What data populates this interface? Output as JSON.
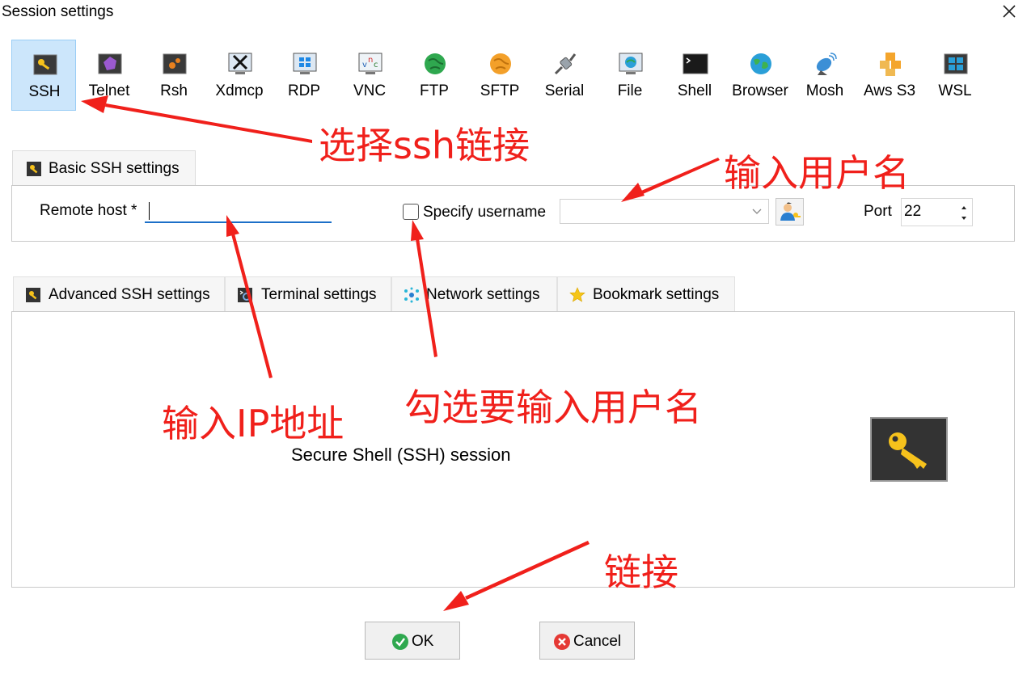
{
  "window": {
    "title": "Session settings"
  },
  "session_types": [
    {
      "label": "SSH",
      "icon": "ssh-key-icon",
      "selected": true
    },
    {
      "label": "Telnet",
      "icon": "telnet-icon",
      "selected": false
    },
    {
      "label": "Rsh",
      "icon": "rsh-icon",
      "selected": false
    },
    {
      "label": "Xdmcp",
      "icon": "xdmcp-icon",
      "selected": false
    },
    {
      "label": "RDP",
      "icon": "rdp-icon",
      "selected": false
    },
    {
      "label": "VNC",
      "icon": "vnc-icon",
      "selected": false
    },
    {
      "label": "FTP",
      "icon": "ftp-globe-icon",
      "selected": false
    },
    {
      "label": "SFTP",
      "icon": "sftp-globe-icon",
      "selected": false
    },
    {
      "label": "Serial",
      "icon": "serial-plug-icon",
      "selected": false
    },
    {
      "label": "File",
      "icon": "file-monitor-icon",
      "selected": false
    },
    {
      "label": "Shell",
      "icon": "shell-terminal-icon",
      "selected": false
    },
    {
      "label": "Browser",
      "icon": "browser-globe-icon",
      "selected": false
    },
    {
      "label": "Mosh",
      "icon": "mosh-satellite-icon",
      "selected": false
    },
    {
      "label": "Aws S3",
      "icon": "aws-s3-icon",
      "selected": false
    },
    {
      "label": "WSL",
      "icon": "wsl-windows-icon",
      "selected": false
    }
  ],
  "basic": {
    "tab_label": "Basic SSH settings",
    "remote_host_label": "Remote host *",
    "remote_host_value": "",
    "specify_username_label": "Specify username",
    "specify_username_checked": false,
    "username_value": "",
    "port_label": "Port",
    "port_value": "22"
  },
  "tabs": [
    {
      "label": "Advanced SSH settings",
      "icon": "wrench-key-icon"
    },
    {
      "label": "Terminal settings",
      "icon": "terminal-gear-icon"
    },
    {
      "label": "Network settings",
      "icon": "network-icon"
    },
    {
      "label": "Bookmark settings",
      "icon": "star-icon"
    }
  ],
  "session_description": "Secure Shell (SSH) session",
  "buttons": {
    "ok": "OK",
    "cancel": "Cancel"
  },
  "annotations": {
    "select_ssh": "选择ssh链接",
    "enter_username": "输入用户名",
    "enter_ip": "输入IP地址",
    "check_username": "勾选要输入用户名",
    "connect": "链接"
  },
  "colors": {
    "selected_bg": "#cce6fb",
    "focus_underline": "#1c6fc8",
    "annotation_red": "#f0201b"
  }
}
